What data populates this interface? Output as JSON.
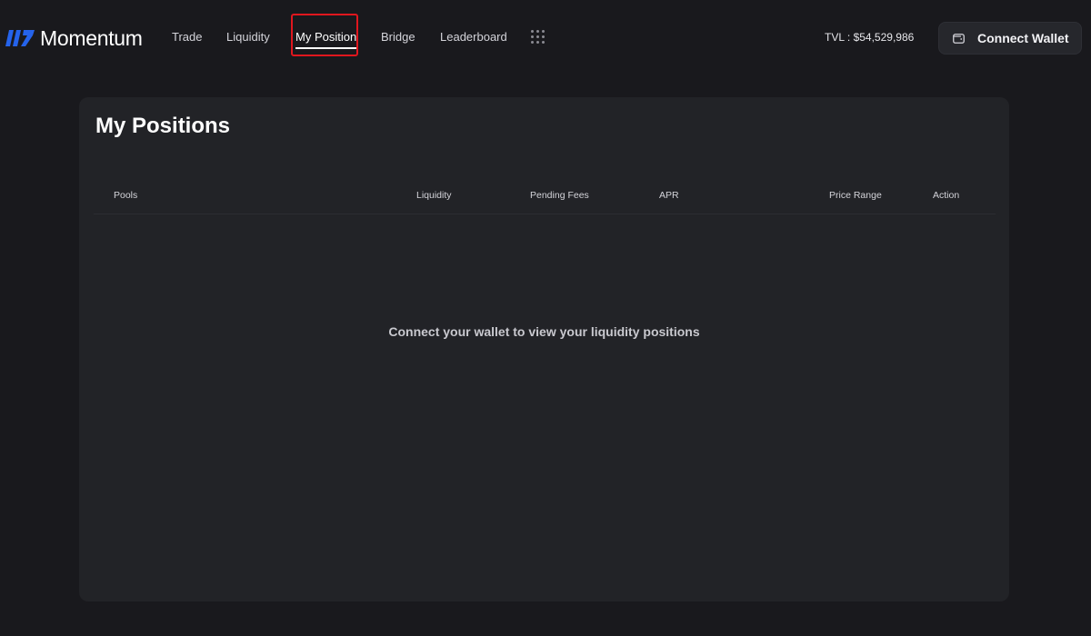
{
  "brand": {
    "name": "Momentum",
    "logo_color": "#2563eb"
  },
  "nav": {
    "items": [
      {
        "label": "Trade",
        "active": false
      },
      {
        "label": "Liquidity",
        "active": false
      },
      {
        "label": "My Position",
        "active": true
      },
      {
        "label": "Bridge",
        "active": false
      },
      {
        "label": "Leaderboard",
        "active": false
      }
    ],
    "more_icon": "grid-dots-icon"
  },
  "header": {
    "tvl_text": "TVL : $54,529,986",
    "connect_wallet_label": "Connect Wallet",
    "wallet_icon": "wallet-icon"
  },
  "positions": {
    "title": "My Positions",
    "columns": [
      "Pools",
      "Liquidity",
      "Pending Fees",
      "APR",
      "Price Range",
      "Action"
    ],
    "rows": [],
    "empty_message": "Connect your wallet to view your liquidity positions"
  },
  "colors": {
    "background": "#19191d",
    "panel": "#222327",
    "highlight": "#e0161e"
  }
}
